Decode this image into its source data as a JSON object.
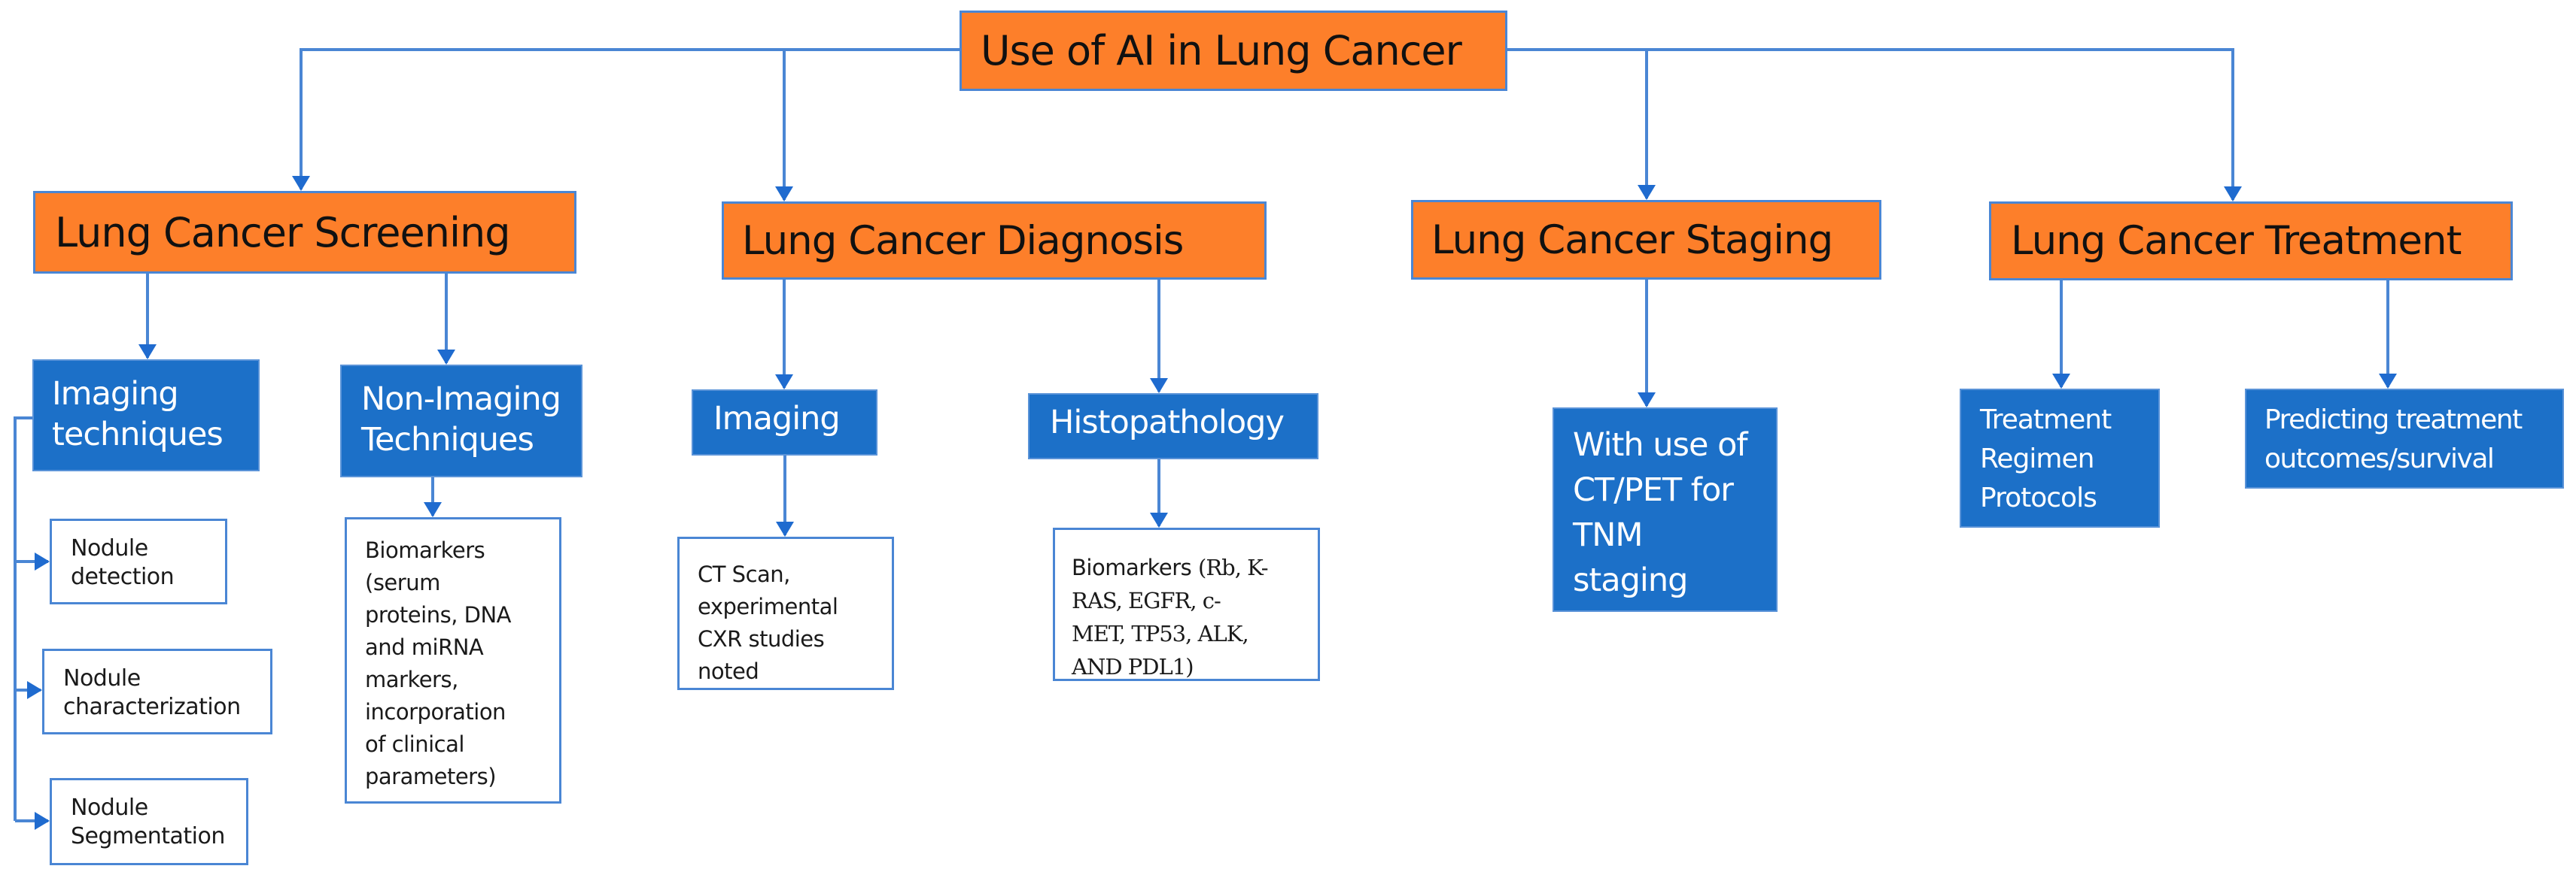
{
  "diagram": {
    "root": {
      "label": "Use of AI in Lung Cancer"
    },
    "branches": [
      {
        "label": "Lung Cancer Screening",
        "children": [
          {
            "label": "Imaging techniques",
            "label_lines": [
              "Imaging",
              "techniques"
            ],
            "children": [
              {
                "label_lines": [
                  "Nodule",
                  "detection"
                ]
              },
              {
                "label_lines": [
                  "Nodule",
                  "characterization"
                ]
              },
              {
                "label_lines": [
                  "Nodule",
                  "Segmentation"
                ]
              }
            ]
          },
          {
            "label": "Non-Imaging Techniques",
            "label_lines": [
              "Non-Imaging",
              "Techniques"
            ],
            "children": [
              {
                "label_lines": [
                  "Biomarkers",
                  "(serum",
                  "proteins, DNA",
                  "and miRNA",
                  "markers,",
                  "incorporation",
                  "of clinical",
                  "parameters)"
                ]
              }
            ]
          }
        ]
      },
      {
        "label": "Lung Cancer Diagnosis",
        "children": [
          {
            "label": "Imaging",
            "children": [
              {
                "label_lines": [
                  "CT Scan,",
                  "experimental",
                  "CXR studies",
                  "noted"
                ]
              }
            ]
          },
          {
            "label": "Histopathology",
            "children": [
              {
                "prefix": "Biomarkers ",
                "label_lines": [
                  "(Rb, K-",
                  "RAS, EGFR, c-",
                  "MET, TP53, ALK,",
                  "AND PDL1)"
                ]
              }
            ]
          }
        ]
      },
      {
        "label": "Lung Cancer Staging",
        "children": [
          {
            "label_lines": [
              "With use of",
              "CT/PET for",
              "TNM",
              "staging"
            ]
          }
        ]
      },
      {
        "label": "Lung Cancer Treatment",
        "children": [
          {
            "label_lines": [
              "Treatment",
              "Regimen",
              "Protocols"
            ]
          },
          {
            "label_lines": [
              "Predicting treatment",
              "outcomes/survival"
            ]
          }
        ]
      }
    ],
    "colors": {
      "level1_fill": "#FD7F2A",
      "level2_fill": "#1C70C8",
      "connector": "#4A86D4",
      "arrowhead": "#1F6BCF"
    }
  }
}
